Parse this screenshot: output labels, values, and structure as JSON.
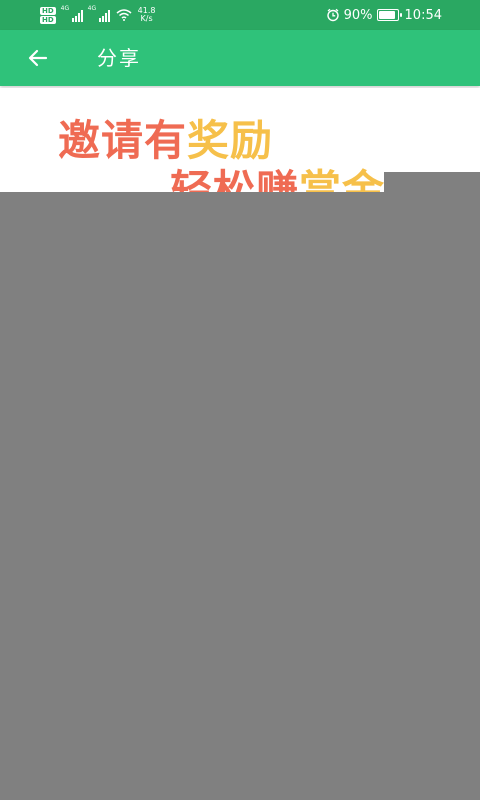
{
  "status_bar": {
    "hd_badges": [
      "HD",
      "HD"
    ],
    "signal1_gen": "4G",
    "signal2_gen": "4G",
    "net_speed_value": "41.8",
    "net_speed_unit": "K/s",
    "battery_percent": "90%",
    "time": "10:54",
    "icons": [
      "hd-icon",
      "signal-icon",
      "wifi-icon",
      "alarm-icon",
      "battery-icon"
    ]
  },
  "app_bar": {
    "back_icon": "arrow-left-icon",
    "title": "分享"
  },
  "banner": {
    "line1_part1": "邀请有",
    "line1_part2": "奖励",
    "line2_part1": "轻松赚",
    "line2_part2": "赏金"
  },
  "colors": {
    "status_bar": "#2aa862",
    "app_bar": "#2fc27a",
    "banner_red": "#ef6b53",
    "banner_yellow": "#f6c04a",
    "overlay_gray": "#808080"
  }
}
